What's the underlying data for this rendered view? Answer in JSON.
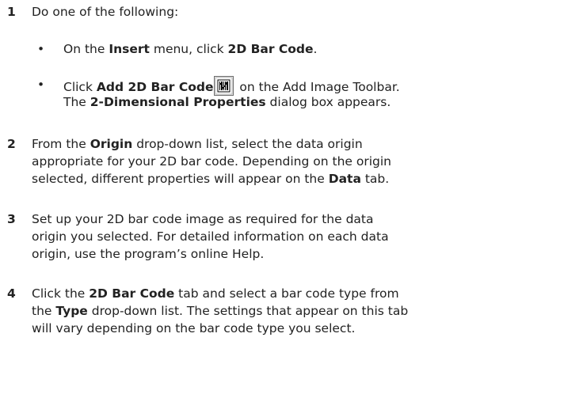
{
  "steps": [
    {
      "number": "1",
      "text": {
        "intro": "Do one of the following:"
      },
      "bullets": [
        {
          "marker": "•",
          "a": "On the ",
          "b": "Insert",
          "c": " menu, click ",
          "d": "2D Bar Code",
          "e": "."
        },
        {
          "marker": "•",
          "a": "Click ",
          "b": "Add 2D Bar Code",
          "icon": "2d-barcode-icon",
          "c": " on the Add Image Toolbar.",
          "d": "The ",
          "e": "2-Dimensional Properties",
          "f": " dialog box appears."
        }
      ]
    },
    {
      "number": "2",
      "l1a": "From the ",
      "l1b": "Origin",
      "l1c": " drop-down list, select the data origin",
      "l2": "appropriate for your 2D bar code. Depending on the origin",
      "l3a": "selected, different properties will appear on the ",
      "l3b": "Data",
      "l3c": " tab."
    },
    {
      "number": "3",
      "l1": "Set up your 2D bar code image as required for the data",
      "l2": "origin you selected. For detailed information on each data",
      "l3": "origin, use the program’s online Help."
    },
    {
      "number": "4",
      "l1a": " Click the ",
      "l1b": "2D Bar Code",
      "l1c": " tab and select a bar code type from",
      "l2a": "the ",
      "l2b": "Type",
      "l2c": " drop-down list. The settings that appear on this tab",
      "l3": "will vary depending on the bar code type you select."
    }
  ]
}
